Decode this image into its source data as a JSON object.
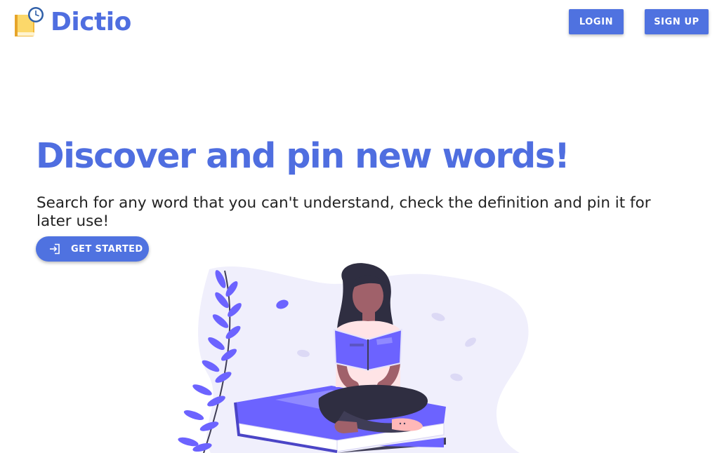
{
  "header": {
    "brand_name": "Dictio",
    "brand_icon": "book-clock-icon",
    "login_label": "LOGIN",
    "signup_label": "SIGN UP"
  },
  "hero": {
    "title": "Discover and pin new words!",
    "subtitle": "Search for any word that you can't understand, check the definition and pin it for later use!",
    "cta_label": "GET STARTED",
    "cta_icon": "login-arrow-icon",
    "illustration": "woman-reading-on-books-illustration"
  },
  "colors": {
    "primary": "#4f72e0",
    "brand_text": "#4f6ee0",
    "illustration_accent": "#6c63ff",
    "blob": "#f0effc"
  }
}
